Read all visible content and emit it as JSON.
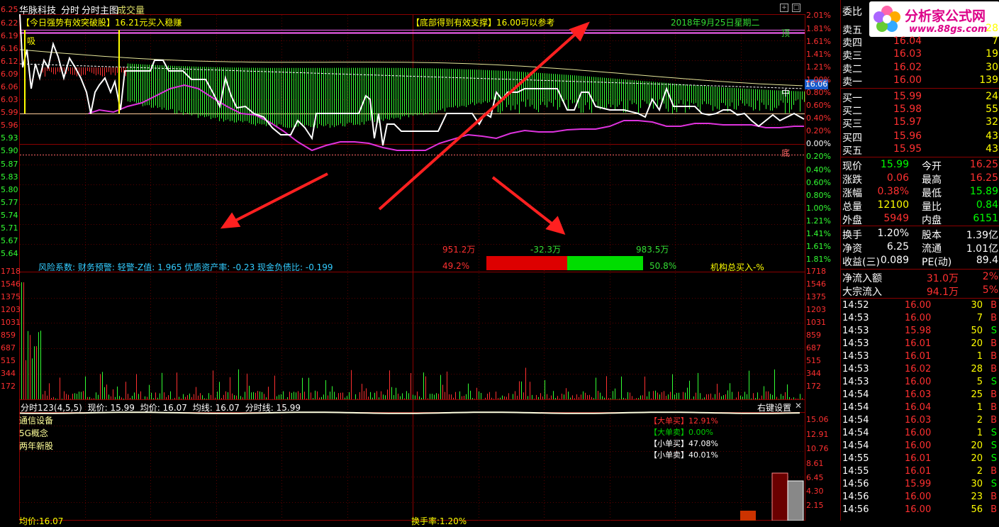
{
  "header": {
    "stock_name": "华脉科技",
    "tab1": "分时",
    "tab2": "分时主图",
    "tab3": "成交量"
  },
  "annotations": {
    "signal_left_tag": "【今日强势有效突破股】",
    "signal_left_text": "16.21元买入稳赚",
    "signal_mid_tag": "【底部得到有效支撑】",
    "signal_mid_text": "16.00可以参考",
    "date": "2018年9月25日星期二",
    "buy_mark": "吸",
    "top_mark": "顶",
    "mid_mark": "中",
    "bottom_mark": "底",
    "current_price_tag": "16.06",
    "risk_line": "风险系数: 财务预警: 轻警-Z值: 1.965 优质资产率: -0.23 现金负债比: -0.199",
    "flow_left_amount": "951.2万",
    "flow_mid_amount": "-32.3万",
    "flow_right_amount": "983.5万",
    "flow_left_pct": "49.2%",
    "flow_right_pct": "50.8%",
    "institution": "机构总买入-%"
  },
  "axes": {
    "price_left": [
      "6.25",
      "6.22",
      "6.19",
      "6.16",
      "6.12",
      "6.09",
      "6.06",
      "6.03",
      "5.99",
      "5.96",
      "5.93",
      "5.90",
      "5.87",
      "5.83",
      "5.80",
      "5.77",
      "5.74",
      "5.71",
      "5.67",
      "5.64"
    ],
    "pct_right": [
      "2.01%",
      "1.81%",
      "1.61%",
      "1.41%",
      "1.21%",
      "1.00%",
      "0.80%",
      "0.60%",
      "0.40%",
      "0.20%",
      "0.00%",
      "0.20%",
      "0.40%",
      "0.60%",
      "0.80%",
      "1.00%",
      "1.21%",
      "1.41%",
      "1.61%",
      "1.81%"
    ],
    "volume_left": [
      "1718",
      "1546",
      "1375",
      "1203",
      "1031",
      "859",
      "687",
      "515",
      "344",
      "172"
    ],
    "volume_right": [
      "1718",
      "1546",
      "1375",
      "1203",
      "1031",
      "859",
      "687",
      "515",
      "344",
      "172"
    ],
    "lower_right": [
      "15.06",
      "12.91",
      "10.76",
      "8.61",
      "6.45",
      "4.30",
      "2.15"
    ]
  },
  "indicator_bar": {
    "title": "分时123(4,5,5)",
    "price": "现价: 15.99",
    "avg": "均价: 16.07",
    "avgline": "均线: 16.07",
    "timeline": "分时线: 15.99",
    "settings": "右键设置"
  },
  "lower_panel": {
    "tags": [
      "通信设备",
      "5G概念",
      "两年新股"
    ],
    "legend": [
      {
        "label": "【大单买】",
        "value": "12.91%",
        "color": "#ff3030"
      },
      {
        "label": "【大单卖】",
        "value": "0.00%",
        "color": "#00d000"
      },
      {
        "label": "【小单买】",
        "value": "47.08%",
        "color": "#ffffff"
      },
      {
        "label": "【小单卖】",
        "value": "40.01%",
        "color": "#ffffff"
      }
    ],
    "bottom_left": "均价:16.07",
    "bottom_mid": "换手率:1.20%"
  },
  "quotes": {
    "title_partial": "委比",
    "sell": [
      {
        "label": "卖五",
        "price": "",
        "vol": "28"
      },
      {
        "label": "卖四",
        "price": "16.04",
        "vol": "7"
      },
      {
        "label": "卖三",
        "price": "16.03",
        "vol": "19"
      },
      {
        "label": "卖二",
        "price": "16.02",
        "vol": "30"
      },
      {
        "label": "卖一",
        "price": "16.00",
        "vol": "139"
      }
    ],
    "buy": [
      {
        "label": "买一",
        "price": "15.99",
        "vol": "24"
      },
      {
        "label": "买二",
        "price": "15.98",
        "vol": "55"
      },
      {
        "label": "买三",
        "price": "15.97",
        "vol": "32"
      },
      {
        "label": "买四",
        "price": "15.96",
        "vol": "43"
      },
      {
        "label": "买五",
        "price": "15.95",
        "vol": "43"
      }
    ]
  },
  "stats": [
    {
      "l1": "现价",
      "v1": "15.99",
      "c1": "#00ff00",
      "l2": "今开",
      "v2": "16.25",
      "c2": "#ff3030"
    },
    {
      "l1": "涨跌",
      "v1": "0.06",
      "c1": "#ff3030",
      "l2": "最高",
      "v2": "16.25",
      "c2": "#ff3030"
    },
    {
      "l1": "涨幅",
      "v1": "0.38%",
      "c1": "#ff3030",
      "l2": "最低",
      "v2": "15.89",
      "c2": "#00ff00"
    },
    {
      "l1": "总量",
      "v1": "12100",
      "c1": "#ffff00",
      "l2": "量比",
      "v2": "0.84",
      "c2": "#00ff00"
    },
    {
      "l1": "外盘",
      "v1": "5949",
      "c1": "#ff3030",
      "l2": "内盘",
      "v2": "6151",
      "c2": "#00ff00"
    }
  ],
  "stats2": [
    {
      "l1": "换手",
      "v1": "1.20%",
      "l2": "股本",
      "v2": "1.39亿"
    },
    {
      "l1": "净资",
      "v1": "6.25",
      "l2": "流通",
      "v2": "1.01亿"
    },
    {
      "l1": "收益(三)",
      "v1": "0.089",
      "l2": "PE(动)",
      "v2": "89.4"
    }
  ],
  "flows": [
    {
      "label": "净流入额",
      "value": "31.0万",
      "pct": "2%"
    },
    {
      "label": "大宗流入",
      "value": "94.1万",
      "pct": "5%"
    }
  ],
  "ticks": [
    {
      "time": "14:52",
      "price": "16.00",
      "vol": "30",
      "side": "B"
    },
    {
      "time": "14:53",
      "price": "16.00",
      "vol": "7",
      "side": "B"
    },
    {
      "time": "14:53",
      "price": "15.98",
      "vol": "50",
      "side": "S"
    },
    {
      "time": "14:53",
      "price": "16.01",
      "vol": "20",
      "side": "B"
    },
    {
      "time": "14:53",
      "price": "16.01",
      "vol": "1",
      "side": "B"
    },
    {
      "time": "14:53",
      "price": "16.02",
      "vol": "28",
      "side": "B"
    },
    {
      "time": "14:53",
      "price": "16.00",
      "vol": "5",
      "side": "S"
    },
    {
      "time": "14:54",
      "price": "16.03",
      "vol": "25",
      "side": "B"
    },
    {
      "time": "14:54",
      "price": "16.04",
      "vol": "1",
      "side": "B"
    },
    {
      "time": "14:54",
      "price": "16.03",
      "vol": "2",
      "side": "B"
    },
    {
      "time": "14:54",
      "price": "16.00",
      "vol": "1",
      "side": "S"
    },
    {
      "time": "14:54",
      "price": "16.00",
      "vol": "20",
      "side": "S"
    },
    {
      "time": "14:55",
      "price": "16.01",
      "vol": "20",
      "side": "S"
    },
    {
      "time": "14:55",
      "price": "16.01",
      "vol": "2",
      "side": "B"
    },
    {
      "time": "14:56",
      "price": "15.99",
      "vol": "30",
      "side": "S"
    },
    {
      "time": "14:56",
      "price": "16.00",
      "vol": "23",
      "side": "B"
    },
    {
      "time": "14:56",
      "price": "16.00",
      "vol": "56",
      "side": "B"
    }
  ],
  "watermark": {
    "name": "分析家公式网",
    "url": "www.88gs.com"
  }
}
